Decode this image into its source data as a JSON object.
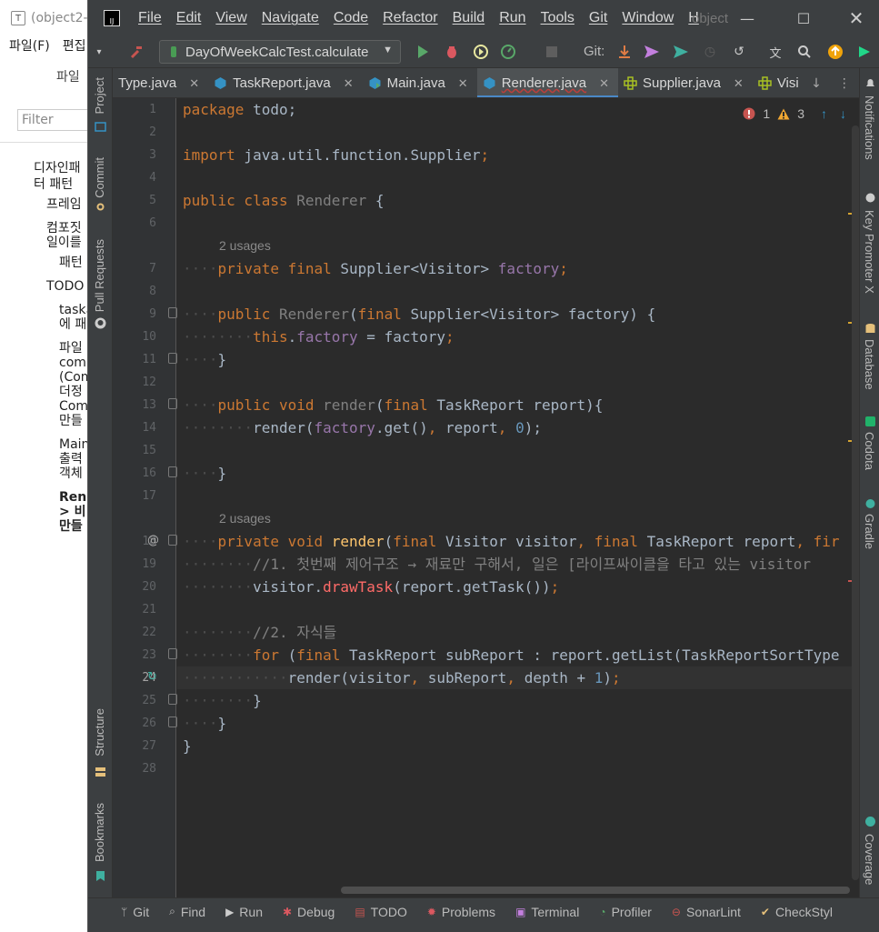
{
  "bg_window": {
    "title": "(object2-",
    "menu": [
      "파일(F)",
      "편집"
    ],
    "file_header": "파일",
    "filter_placeholder": "Filter",
    "tree": [
      "디자인패",
      "터 패턴",
      "프레임",
      "컴포짓",
      "일이를",
      "패턴",
      "TODO",
      "task의",
      "에 패",
      "파일",
      "comp",
      "(Com",
      "더정",
      "Com",
      "만들",
      "Main",
      "출력",
      "객체",
      "Renc",
      "> 비",
      "만들"
    ]
  },
  "ide": {
    "menu": [
      "File",
      "Edit",
      "View",
      "Navigate",
      "Code",
      "Refactor",
      "Build",
      "Run",
      "Tools",
      "Git",
      "Window",
      "H"
    ],
    "project_name": "object",
    "run_config": "DayOfWeekCalcTest.calculate",
    "git_label": "Git:",
    "tabs": [
      {
        "label": "Type.java",
        "icon": "class-icon"
      },
      {
        "label": "TaskReport.java",
        "icon": "class-icon"
      },
      {
        "label": "Main.java",
        "icon": "class-icon"
      },
      {
        "label": "Renderer.java",
        "icon": "class-icon",
        "active": true
      },
      {
        "label": "Supplier.java",
        "icon": "interface-icon"
      },
      {
        "label": "Visi",
        "icon": "interface-icon"
      }
    ],
    "left_tools": [
      "Project",
      "Commit",
      "Pull Requests",
      "Structure",
      "Bookmarks"
    ],
    "right_tools": [
      "Notifications",
      "Key Promoter X",
      "Database",
      "Codota",
      "Gradle",
      "Coverage"
    ],
    "inspections": {
      "errors": "1",
      "warnings": "3"
    },
    "usage_hints": [
      "2 usages",
      "2 usages"
    ],
    "code": {
      "l1": [
        "package",
        " todo;"
      ],
      "l3": [
        "import",
        " java.util.function.Supplier",
        ";"
      ],
      "l5": [
        "public",
        " class",
        " Renderer",
        " {"
      ],
      "l7": [
        "private",
        " final",
        " Supplier<Visitor> ",
        "factory",
        ";"
      ],
      "l9": [
        "public",
        " Renderer",
        "(",
        "final",
        " Supplier<Visitor> factory) {"
      ],
      "l10": [
        "this",
        ".",
        "factory",
        " = factory",
        ";"
      ],
      "l11": [
        "}"
      ],
      "l13": [
        "public",
        " void",
        " render",
        "(",
        "final",
        " TaskReport report){"
      ],
      "l14": [
        "render(",
        "factory",
        ".get()",
        ", ",
        "report",
        ", ",
        "0",
        ");"
      ],
      "l16": [
        "}"
      ],
      "l18": [
        "private",
        " void",
        " render",
        "(",
        "final",
        " Visitor visitor",
        ", ",
        "final",
        " TaskReport report",
        ", ",
        "fir"
      ],
      "l19": [
        "//1. 첫번째 제어구조 → 재료만 구해서, 일은 [라이프싸이클을 타고 있는 visitor"
      ],
      "l20": [
        "visitor.",
        "drawTask",
        "(report.getTask())",
        ";"
      ],
      "l22": [
        "//2. 자식들"
      ],
      "l23": [
        "for",
        " (",
        "final",
        " TaskReport subReport : report.getList(TaskReportSortType"
      ],
      "l24": [
        "render(visitor",
        ", ",
        "subReport",
        ", ",
        "depth + ",
        "1",
        ")",
        ";"
      ],
      "l25": [
        "}"
      ],
      "l26": [
        "}"
      ],
      "l27": [
        "}"
      ]
    },
    "line_numbers": [
      "1",
      "2",
      "3",
      "4",
      "5",
      "6",
      "7",
      "8",
      "9",
      "10",
      "11",
      "12",
      "13",
      "14",
      "15",
      "16",
      "17",
      "18",
      "19",
      "20",
      "21",
      "22",
      "23",
      "24",
      "25",
      "26",
      "27",
      "28"
    ],
    "bottom_tools": [
      {
        "label": "Git",
        "icon": "git-branch-icon"
      },
      {
        "label": "Find",
        "icon": "find-icon"
      },
      {
        "label": "Run",
        "icon": "run-icon"
      },
      {
        "label": "Debug",
        "icon": "debug-icon"
      },
      {
        "label": "TODO",
        "icon": "todo-icon"
      },
      {
        "label": "Problems",
        "icon": "problems-icon"
      },
      {
        "label": "Terminal",
        "icon": "terminal-icon"
      },
      {
        "label": "Profiler",
        "icon": "profiler-icon"
      },
      {
        "label": "SonarLint",
        "icon": "sonarlint-icon"
      },
      {
        "label": "CheckStyl",
        "icon": "checkstyle-icon"
      }
    ],
    "colors": {
      "keyword": "#cc7832",
      "field": "#9876aa",
      "method": "#ffc66d",
      "number": "#6897bb",
      "comment": "#808080",
      "text": "#a9b7c6"
    }
  }
}
